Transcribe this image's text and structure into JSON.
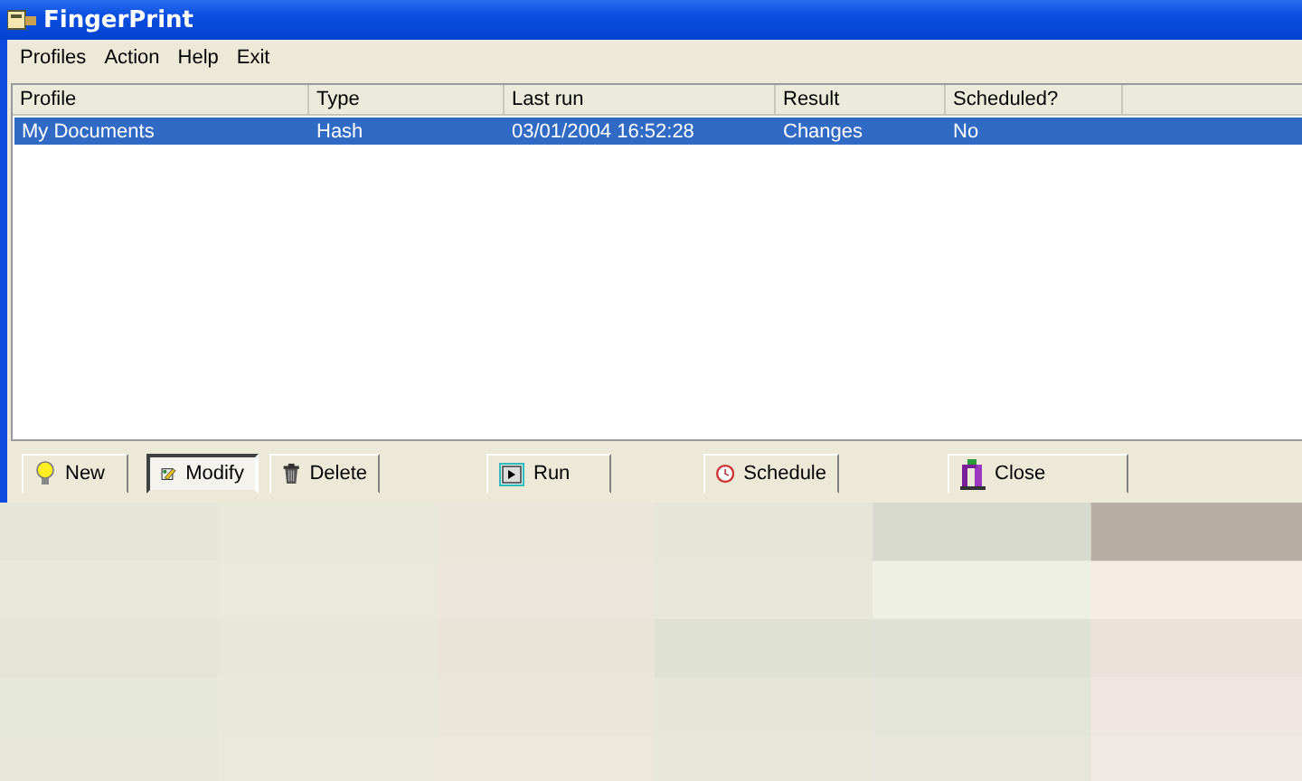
{
  "window": {
    "title": "FingerPrint"
  },
  "menu": [
    "Profiles",
    "Action",
    "Help",
    "Exit"
  ],
  "table": {
    "columns": [
      "Profile",
      "Type",
      "Last run",
      "Result",
      "Scheduled?"
    ],
    "rows": [
      {
        "cells": [
          "My Documents",
          "Hash",
          "03/01/2004 16:52:28",
          "Changes",
          "No"
        ],
        "selected": true
      }
    ]
  },
  "buttons": [
    {
      "label": "New",
      "kind": "new",
      "pressed": false
    },
    {
      "label": "Modify",
      "kind": "modify",
      "pressed": true
    },
    {
      "label": "Delete",
      "kind": "delete",
      "pressed": false
    },
    {
      "label": "Run",
      "kind": "run",
      "pressed": false
    },
    {
      "label": "Schedule",
      "kind": "schedule",
      "pressed": false
    },
    {
      "label": "Close",
      "kind": "close",
      "pressed": false
    }
  ],
  "background": {
    "kind": "picture"
  }
}
